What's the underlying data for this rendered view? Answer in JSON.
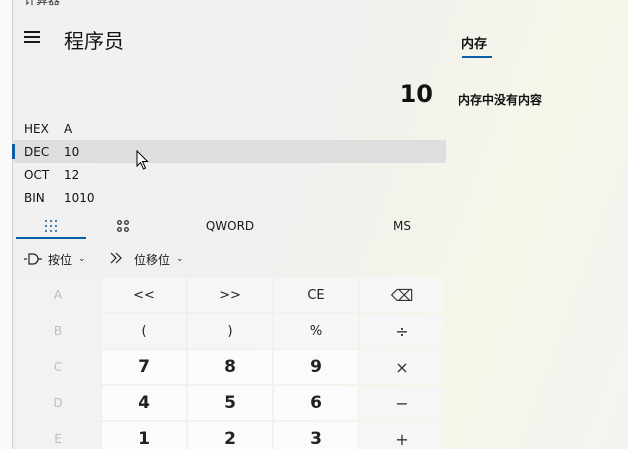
{
  "window": {
    "title": "计算器"
  },
  "header": {
    "mode": "程序员"
  },
  "display": {
    "value": "10"
  },
  "radix": [
    {
      "name": "HEX",
      "value": "A"
    },
    {
      "name": "DEC",
      "value": "10"
    },
    {
      "name": "OCT",
      "value": "12"
    },
    {
      "name": "BIN",
      "value": "1010"
    }
  ],
  "tabs": {
    "word": "QWORD",
    "ms": "MS"
  },
  "bitops": {
    "bitwise": "按位",
    "shift": "位移位"
  },
  "keys": {
    "r0": [
      "A",
      "<<",
      ">>",
      "CE",
      "⌫"
    ],
    "r1": [
      "B",
      "(",
      ")",
      "%",
      "÷"
    ],
    "r2": [
      "C",
      "7",
      "8",
      "9",
      "×"
    ],
    "r3": [
      "D",
      "4",
      "5",
      "6",
      "−"
    ],
    "r4": [
      "E",
      "1",
      "2",
      "3",
      "+"
    ]
  },
  "memory": {
    "tab": "内存",
    "empty": "内存中没有内容"
  }
}
